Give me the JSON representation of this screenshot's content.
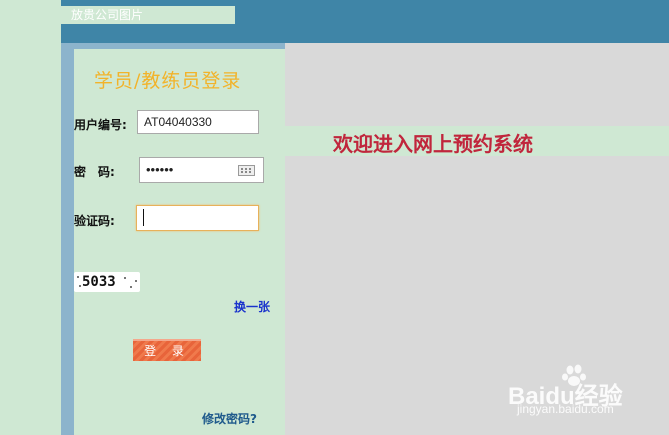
{
  "header": {
    "company_image_label": "放贵公司图片"
  },
  "login_panel": {
    "title": "学员/教练员登录",
    "user_label": "用户编号:",
    "user_value": "AT04040330",
    "password_label": "密　码:",
    "password_value": "••••••",
    "captcha_label": "验证码:",
    "captcha_value": "",
    "captcha_code": "5033",
    "refresh_link": "换一张",
    "login_button": "登 录",
    "change_password_link": "修改密码?"
  },
  "welcome": {
    "text": "欢迎进入网上预约系统"
  },
  "watermark": {
    "brand": "Baidu经验",
    "url": "jingyan.baidu.com"
  }
}
